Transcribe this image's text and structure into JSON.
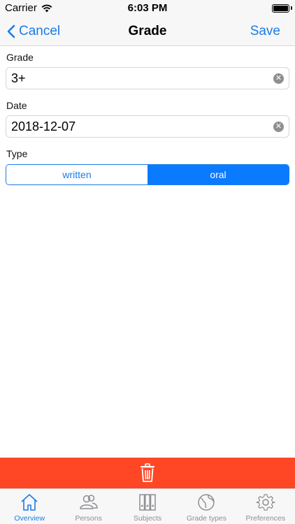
{
  "status_bar": {
    "carrier": "Carrier",
    "time": "6:03 PM"
  },
  "nav": {
    "cancel_label": "Cancel",
    "title": "Grade",
    "save_label": "Save"
  },
  "form": {
    "grade_label": "Grade",
    "grade_value": "3+",
    "date_label": "Date",
    "date_value": "2018-12-07",
    "type_label": "Type",
    "type_options": [
      "written",
      "oral"
    ],
    "type_selected": "oral"
  },
  "tabs": [
    {
      "label": "Overview",
      "icon": "house-icon",
      "active": true
    },
    {
      "label": "Persons",
      "icon": "persons-icon",
      "active": false
    },
    {
      "label": "Subjects",
      "icon": "binders-icon",
      "active": false
    },
    {
      "label": "Grade types",
      "icon": "globe-icon",
      "active": false
    },
    {
      "label": "Preferences",
      "icon": "gear-icon",
      "active": false
    }
  ],
  "colors": {
    "accent": "#1a7ce8",
    "segment_selected": "#0a7aff",
    "delete_bar": "#ff4726",
    "inactive": "#8e8e93"
  }
}
